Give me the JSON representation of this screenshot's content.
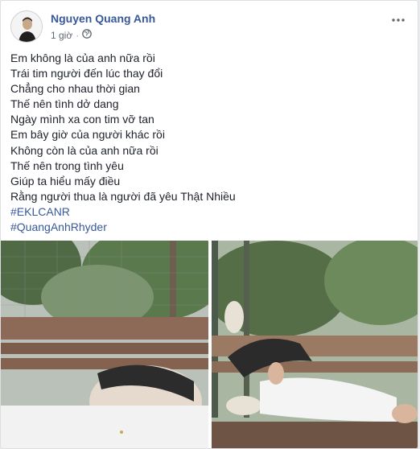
{
  "post": {
    "author": "Nguyen Quang Anh",
    "time": "1 giờ",
    "separator": "·",
    "more_icon": "more-options-icon",
    "privacy_icon": "globe-icon",
    "lines": [
      "Em không là của anh nữa rồi",
      "Trái tim người đến lúc thay đổi",
      "Chẳng cho nhau thời gian",
      "Thế nên tình dở dang",
      "Ngày mình xa con tim vỡ tan",
      "Em bây giờ của người khác rồi",
      "Không còn là của anh nữa rồi",
      "Thế nên trong tình yêu",
      "Giúp ta hiểu mấy điều",
      "Rằng người thua là người đã yêu Thật Nhiều"
    ],
    "hashtags": [
      "#EKLCANR",
      "#QuangAnhRhyder"
    ]
  },
  "colors": {
    "link": "#385898",
    "text": "#1d2129",
    "meta": "#616770"
  }
}
